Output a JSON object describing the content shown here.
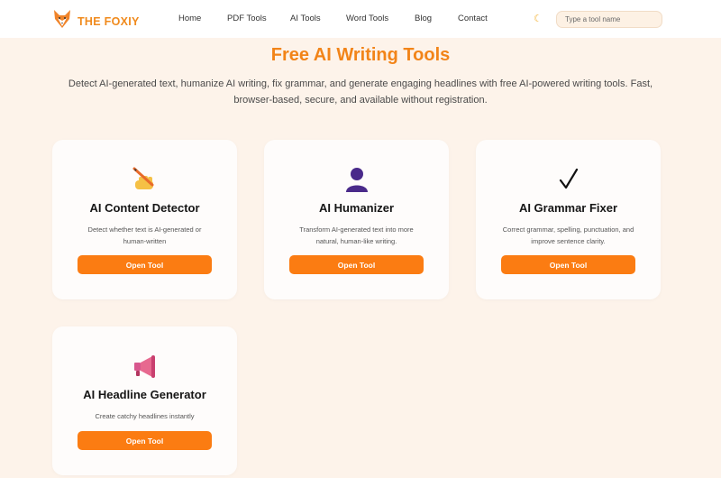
{
  "brand": {
    "name": "THE FOXIY",
    "logo_icon": "fox-icon",
    "accent": "#f08a1c"
  },
  "nav": {
    "items": [
      "Home",
      "PDF Tools",
      "AI Tools",
      "Word Tools",
      "Blog",
      "Contact"
    ]
  },
  "theme_toggle": {
    "icon": "moon-icon"
  },
  "search": {
    "placeholder": "Type a tool name",
    "value": ""
  },
  "main": {
    "title": "Free AI Writing Tools",
    "intro": "Detect AI-generated text, humanize AI writing, fix grammar, and generate engaging headlines with free AI-powered writing tools. Fast, browser-based, secure, and available without registration."
  },
  "tools": [
    {
      "icon": "writing-hand-icon",
      "title": "AI Content Detector",
      "description": "Detect whether text is AI-generated or human-written",
      "button": "Open Tool"
    },
    {
      "icon": "person-silhouette-icon",
      "title": "AI Humanizer",
      "description": "Transform AI-generated text into more natural, human-like writing.",
      "button": "Open Tool"
    },
    {
      "icon": "check-mark-icon",
      "title": "AI Grammar Fixer",
      "description": "Correct grammar, spelling, punctuation, and improve sentence clarity.",
      "button": "Open Tool"
    },
    {
      "icon": "megaphone-icon",
      "title": "AI Headline Generator",
      "description": "Create catchy headlines instantly",
      "button": "Open Tool"
    }
  ],
  "colors": {
    "button": "#fb7c12",
    "title": "#f28418",
    "background": "#fdf3ea"
  }
}
